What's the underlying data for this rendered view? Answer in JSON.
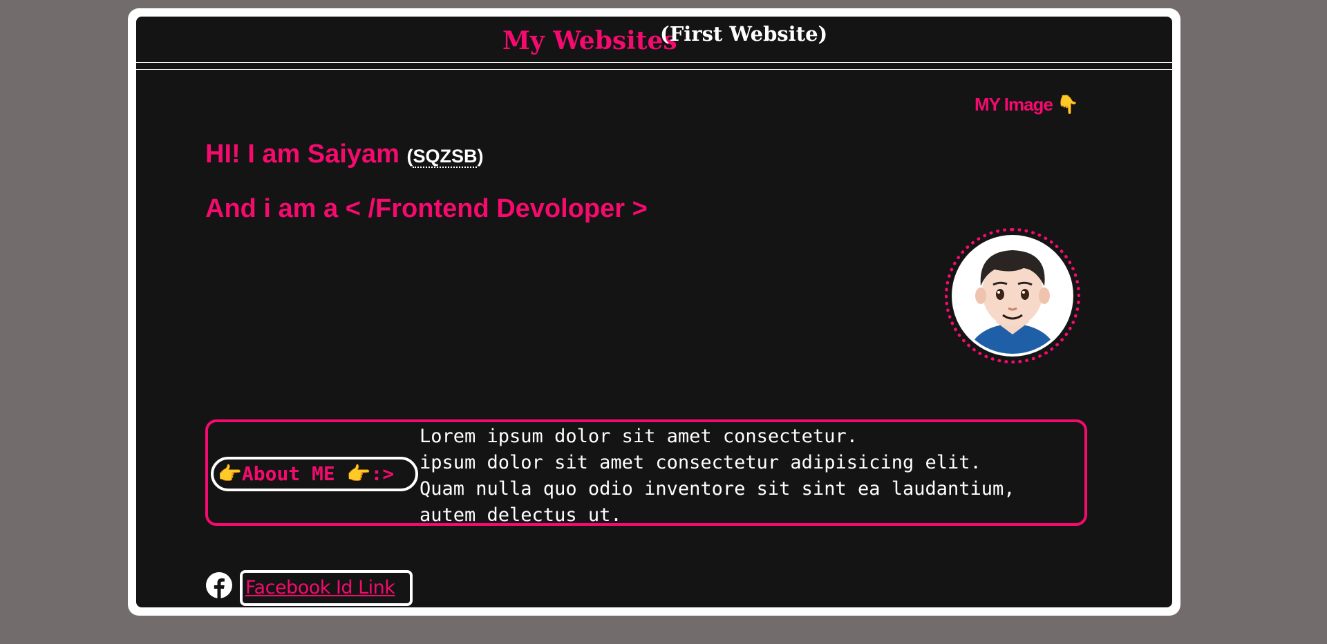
{
  "header": {
    "title": "My Websites",
    "subtitle": "(First Website)"
  },
  "image_section": {
    "label": "MY Image",
    "pointer_icon": "backhand-index-pointing-down-icon",
    "avatar_icon": "man-avatar-icon"
  },
  "intro": {
    "greeting": "HI! I am Saiyam ",
    "nickname_open": "(",
    "nickname": "SQZSB",
    "nickname_close": ")",
    "role": "And i am a < /Frontend Devoloper >"
  },
  "about": {
    "label": "About ME",
    "label_suffix": ":>",
    "lines": [
      "Lorem ipsum dolor sit amet consectetur.",
      "ipsum dolor sit amet consectetur adipisicing elit.",
      "Quam nulla quo odio inventore sit sint ea laudantium,",
      "autem delectus ut."
    ]
  },
  "social": {
    "icon": "facebook-icon",
    "link_text": "Facebook Id Link"
  },
  "colors": {
    "accent": "#f50a6e",
    "panel_bg": "#141414",
    "page_bg": "#726c6d",
    "emoji_yellow": "#f5b21f",
    "text_white": "#ffffff"
  }
}
